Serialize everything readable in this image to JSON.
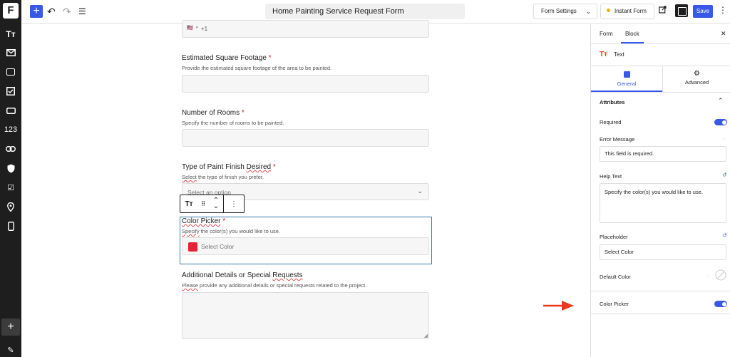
{
  "sidebar": {
    "logo": "F",
    "icons": [
      "text-icon",
      "mail-icon",
      "input-box-icon",
      "checkbox-icon",
      "button-icon",
      "number-icon",
      "link-icon",
      "shield-icon",
      "checklist-icon",
      "location-icon",
      "phone-icon"
    ],
    "number_label": "123",
    "add_label": "+",
    "edit_label": "✎"
  },
  "topbar": {
    "add_label": "+",
    "undo_label": "↶",
    "redo_label": "↷",
    "list_label": "☰",
    "title": "Home Painting Service Request Form",
    "form_settings_label": "Form Settings",
    "instant_form_label": "Instant Form",
    "save_label": "Save",
    "more_label": "⋮",
    "accent": "#3858e9"
  },
  "form": {
    "phone": {
      "flag": "🇺🇸",
      "code": "+1"
    },
    "sqft": {
      "label": "Estimated Square Footage",
      "required_mark": "*",
      "help": "Provide the estimated square footage of the area to be painted."
    },
    "rooms": {
      "label": "Number of Rooms",
      "required_mark": "*",
      "help": "Specify the number of rooms to be painted."
    },
    "finish": {
      "label_pre": "Type of Paint Finish ",
      "label_squiggle": "Desired",
      "required_mark": "*",
      "help_squiggle": "Select",
      "help_rest": " the type of finish you prefer.",
      "placeholder": "Select an option"
    },
    "color": {
      "label_squiggle": "Color Picker",
      "required_mark": "*",
      "help_squiggle": "Specify",
      "help_rest": " the color(s) you would like to use.",
      "placeholder": "Select Color",
      "swatch": "#e52535"
    },
    "details": {
      "label_pre": "Additional Details or Special ",
      "label_squiggle": "Requests",
      "help_squiggle": "Please",
      "help_rest": " provide any additional details or special requests related to the project."
    }
  },
  "block_toolbar": {
    "type_label": "Tт",
    "drag_label": "⠿",
    "up_label": "⌃",
    "down_label": "⌄",
    "more_label": "⋮"
  },
  "panel": {
    "tab_form": "Form",
    "tab_block": "Block",
    "close_label": "✕",
    "block_name": "Text",
    "block_icon_label": "Tт",
    "subtab_general": "General",
    "subtab_advanced": "Advanced",
    "attributes_label": "Attributes",
    "required_label": "Required",
    "error_message_label": "Error Message",
    "error_message_value": "This field is required.",
    "help_text_label": "Help Text",
    "help_text_value": "Specify the color(s) you would like to use.",
    "placeholder_label": "Placeholder",
    "placeholder_value": "Select Color",
    "default_color_label": "Default Color",
    "color_picker_label": "Color Picker",
    "required_on": true,
    "color_picker_on": true,
    "arrow_color": "#e8391f"
  }
}
